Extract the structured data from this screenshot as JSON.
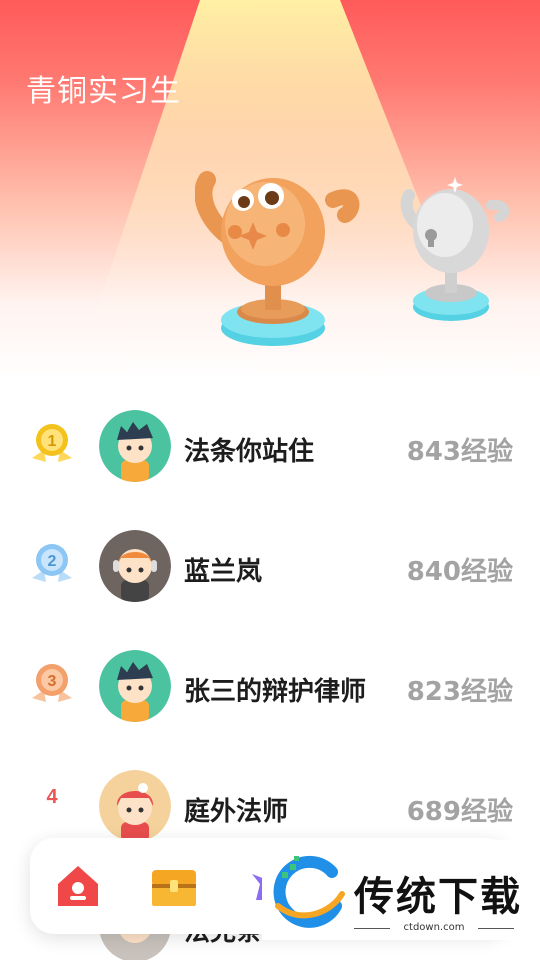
{
  "header": {
    "rank_title": "青铜实习生"
  },
  "colors": {
    "hero_top": "#ff5a5a",
    "gold": "#f4c21c",
    "silver_blue": "#8cc6f5",
    "bronze": "#f3a06b",
    "rank_red": "#e85656",
    "score_gray": "#a3a3a3"
  },
  "leaderboard": [
    {
      "rank": "1",
      "medal": "gold-medal-icon",
      "name": "法条你站住",
      "score": "843经验"
    },
    {
      "rank": "2",
      "medal": "silver-medal-icon",
      "name": "蓝兰岚",
      "score": "840经验"
    },
    {
      "rank": "3",
      "medal": "bronze-medal-icon",
      "name": "张三的辩护律师",
      "score": "823经验"
    },
    {
      "rank": "4",
      "medal": "",
      "name": "庭外法师",
      "score": "689经验"
    },
    {
      "rank": "",
      "medal": "",
      "name": "法克条",
      "score": ""
    }
  ],
  "tabbar": {
    "tabs": [
      "home-icon",
      "treasure-chest-icon",
      "unicorn-icon"
    ]
  },
  "watermark": {
    "text": "传统下载",
    "url": "ctdown.com"
  }
}
